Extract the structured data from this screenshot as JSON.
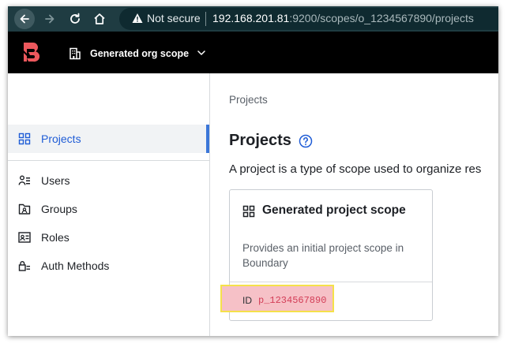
{
  "browser": {
    "security_label": "Not secure",
    "url_host": "192.168.201.81",
    "url_rest": ":9200/scopes/o_1234567890/projects"
  },
  "header": {
    "org_scope": "Generated org scope"
  },
  "sidebar": {
    "items": [
      {
        "label": "Projects",
        "icon": "grid-icon",
        "active": true
      },
      {
        "label": "Users",
        "icon": "users-icon"
      },
      {
        "label": "Groups",
        "icon": "groups-icon"
      },
      {
        "label": "Roles",
        "icon": "roles-icon"
      },
      {
        "label": "Auth Methods",
        "icon": "auth-methods-icon"
      }
    ]
  },
  "main": {
    "breadcrumb": "Projects",
    "title": "Projects",
    "description": "A project is a type of scope used to organize res",
    "card": {
      "title": "Generated project scope",
      "description": "Provides an initial project scope in Boundary",
      "id_label": "ID",
      "id_value": "p_1234567890"
    }
  },
  "colors": {
    "browser_bar": "#1f3c42",
    "header": "#000000",
    "accent": "#1f5cd6",
    "logo": "#ec585d",
    "id_value": "#d33d57"
  }
}
